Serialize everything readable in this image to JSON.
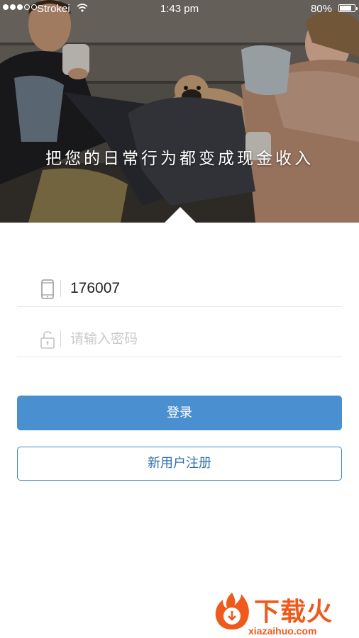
{
  "status_bar": {
    "carrier": "Strokei",
    "time": "1:43 pm",
    "battery_percent": "80%",
    "battery_level": 0.8,
    "signal_bars_filled": 3,
    "signal_bars_total": 5
  },
  "hero": {
    "tagline": "把您的日常行为都变成现金收入"
  },
  "login_form": {
    "phone_value": "176007",
    "password_placeholder": "请输入密码",
    "login_label": "登录",
    "register_label": "新用户注册"
  },
  "watermark": {
    "title": "下载火",
    "site": "xiazaihuo.com"
  },
  "colors": {
    "primary_button": "#4a8fd0",
    "register_border": "#3a86c8",
    "register_text": "#2f6fab",
    "watermark": "#ee5a1c"
  },
  "icons": {
    "phone_field": "mobile-phone-icon",
    "password_field": "unlock-icon",
    "wifi": "wifi-icon",
    "battery": "battery-icon"
  }
}
